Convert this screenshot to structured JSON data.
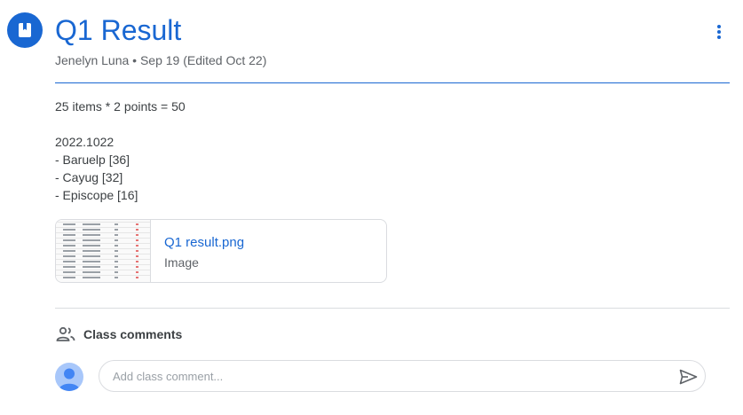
{
  "post": {
    "icon": "assignment-bookmark-icon",
    "title": "Q1 Result",
    "meta": "Jenelyn Luna • Sep 19 (Edited Oct 22)",
    "body_lines": [
      "25 items * 2 points = 50",
      "",
      "2022.1022",
      "- Baruelp [36]",
      "- Cayug [32]",
      "- Episcope [16]"
    ]
  },
  "attachment": {
    "name": "Q1 result.png",
    "type": "Image"
  },
  "comments": {
    "icon": "people-icon",
    "label": "Class comments",
    "placeholder": "Add class comment..."
  },
  "colors": {
    "accent": "#1967d2",
    "text": "#3c4043",
    "muted": "#5f6368",
    "border": "#dadce0"
  }
}
